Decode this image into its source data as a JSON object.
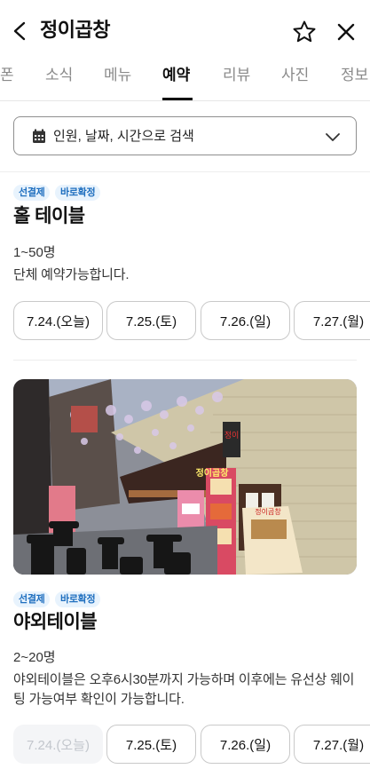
{
  "header": {
    "title": "정이곱창",
    "back_icon": "chevron-left-icon",
    "favorite_icon": "star-outline-icon",
    "close_icon": "close-icon"
  },
  "tabs": [
    {
      "label": "폰",
      "active": false
    },
    {
      "label": "소식",
      "active": false
    },
    {
      "label": "메뉴",
      "active": false
    },
    {
      "label": "예약",
      "active": true
    },
    {
      "label": "리뷰",
      "active": false
    },
    {
      "label": "사진",
      "active": false
    },
    {
      "label": "정보",
      "active": false
    }
  ],
  "search": {
    "label": "인원, 날짜, 시간으로 검색",
    "icon": "calendar-icon",
    "dropdown_icon": "chevron-down-icon"
  },
  "items": [
    {
      "badges": [
        "선결제",
        "바로확정"
      ],
      "title": "홀 테이블",
      "capacity": "1~50명",
      "description": "단체 예약가능합니다.",
      "dates": [
        {
          "label": "7.24.(오늘)",
          "disabled": false
        },
        {
          "label": "7.25.(토)",
          "disabled": false
        },
        {
          "label": "7.26.(일)",
          "disabled": false
        },
        {
          "label": "7.27.(월)",
          "disabled": false
        }
      ]
    },
    {
      "badges": [
        "선결제",
        "바로확정"
      ],
      "title": "야외테이블",
      "capacity": "2~20명",
      "description": "야외테이블은 오후6시30분까지 가능하며 이후에는 유선상 웨이팅 가능여부 확인이 가능합니다.",
      "dates": [
        {
          "label": "7.24.(오늘)",
          "disabled": true
        },
        {
          "label": "7.25.(토)",
          "disabled": false
        },
        {
          "label": "7.26.(일)",
          "disabled": false
        },
        {
          "label": "7.27.(월)",
          "disabled": false
        }
      ]
    }
  ],
  "photo": {
    "sign_text": "정이곱창",
    "menu_board_text": "정이곱창"
  },
  "colors": {
    "badge_bg": "#e8f3fd",
    "badge_text": "#1f6fbf",
    "active_tab": "#111111",
    "inactive_tab": "#8a8a8a",
    "disabled_chip_bg": "#f4f5f7"
  }
}
